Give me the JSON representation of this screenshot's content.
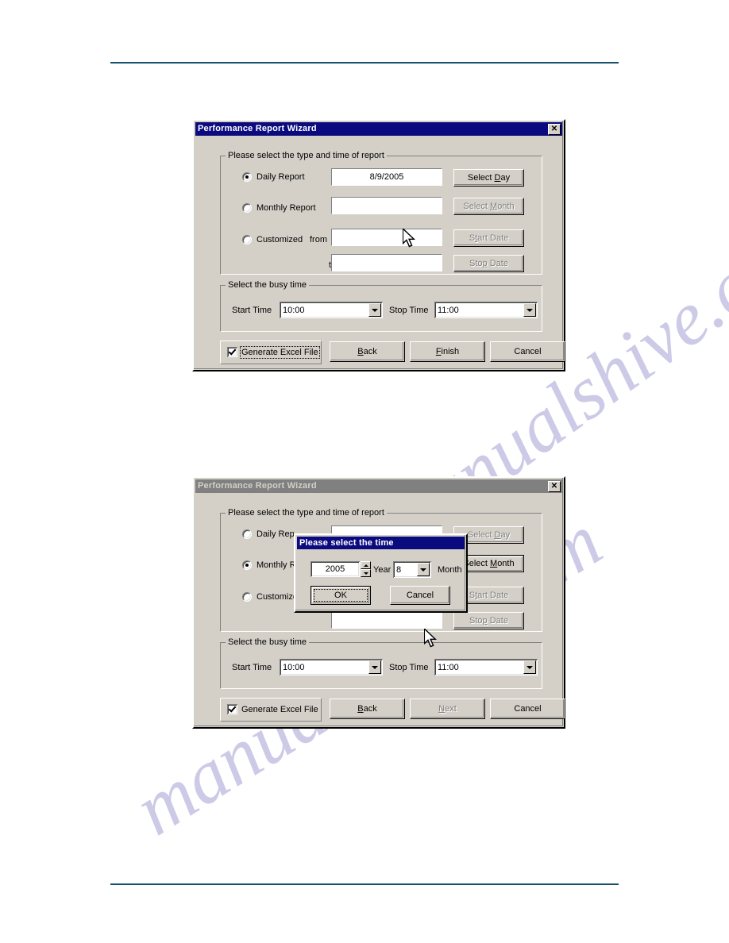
{
  "page": {
    "header_rule_color": "#17506b",
    "footer_rule_color": "#17506b",
    "watermark_1": "manualshive.com",
    "watermark_2": "manualshive.com"
  },
  "colors": {
    "dialog_face": "#d4d0c8",
    "titlebar_active": "#0b0b80",
    "titlebar_inactive": "#808080",
    "field_bg": "#ffffff",
    "disabled_text": "#808080"
  },
  "dialog_1": {
    "title": "Performance Report Wizard",
    "close_label": "✕",
    "group_type": {
      "label": "Please select the type and time of report",
      "options": [
        {
          "label": "Daily Report",
          "checked": true
        },
        {
          "label": "Monthly Report",
          "checked": false
        },
        {
          "label": "Customized",
          "checked": false
        }
      ],
      "from_label": "from",
      "to_label": "to",
      "fields": {
        "daily_value": "8/9/2005",
        "monthly_value": "",
        "from_value": "",
        "to_value": ""
      },
      "buttons": [
        {
          "label_pre": "Select ",
          "label_acc": "D",
          "label_post": "ay",
          "enabled": true
        },
        {
          "label_pre": "Select ",
          "label_acc": "M",
          "label_post": "onth",
          "enabled": false
        },
        {
          "label_pre": "S",
          "label_acc": "t",
          "label_post": "art Date",
          "enabled": false
        },
        {
          "label_pre": "Sto",
          "label_acc": "p",
          "label_post": " Date",
          "enabled": false
        }
      ]
    },
    "group_busy": {
      "label": "Select the busy time",
      "start_label": "Start Time",
      "start_value": "10:00",
      "stop_label": "Stop Time",
      "stop_value": "11:00"
    },
    "footer": {
      "checkbox_label": "Generate Excel File",
      "checkbox_checked": true,
      "checkbox_focused": true,
      "back": {
        "pre": "",
        "acc": "B",
        "post": "ack"
      },
      "middle": {
        "pre": "",
        "acc": "F",
        "post": "inish",
        "enabled": true
      },
      "cancel": {
        "pre": "Cancel",
        "acc": "",
        "post": "",
        "enabled": true
      }
    }
  },
  "dialog_2": {
    "title": "Performance Report Wizard",
    "close_label": "✕",
    "group_type": {
      "label": "Please select the type and time of report",
      "options": [
        {
          "label": "Daily Rep",
          "checked": false
        },
        {
          "label": "Monthly R",
          "checked": true
        },
        {
          "label": "Customize",
          "checked": false
        }
      ],
      "fields": {
        "daily_value": "",
        "monthly_value": "",
        "from_value": "",
        "to_value": ""
      },
      "buttons": [
        {
          "label_pre": "Select ",
          "label_acc": "D",
          "label_post": "ay",
          "enabled": false
        },
        {
          "label_pre": "Select ",
          "label_acc": "M",
          "label_post": "onth",
          "enabled": true
        },
        {
          "label_pre": "S",
          "label_acc": "t",
          "label_post": "art Date",
          "enabled": false
        },
        {
          "label_pre": "Sto",
          "label_acc": "p",
          "label_post": " Date",
          "enabled": false
        }
      ]
    },
    "group_busy": {
      "label": "Select the busy time",
      "start_label": "Start Time",
      "start_value": "10:00",
      "stop_label": "Stop Time",
      "stop_value": "11:00"
    },
    "footer": {
      "checkbox_label": "Generate Excel File",
      "checkbox_checked": true,
      "checkbox_focused": false,
      "back": {
        "pre": "",
        "acc": "B",
        "post": "ack"
      },
      "middle": {
        "pre": "",
        "acc": "N",
        "post": "ext",
        "enabled": false
      },
      "cancel": {
        "pre": "Cancel",
        "acc": "",
        "post": "",
        "enabled": true
      }
    },
    "inner_dialog": {
      "title": "Please select the time",
      "year_value": "2005",
      "year_label": "Year",
      "month_value": "8",
      "month_label": "Month",
      "ok_label": "OK",
      "cancel_label": "Cancel"
    }
  }
}
